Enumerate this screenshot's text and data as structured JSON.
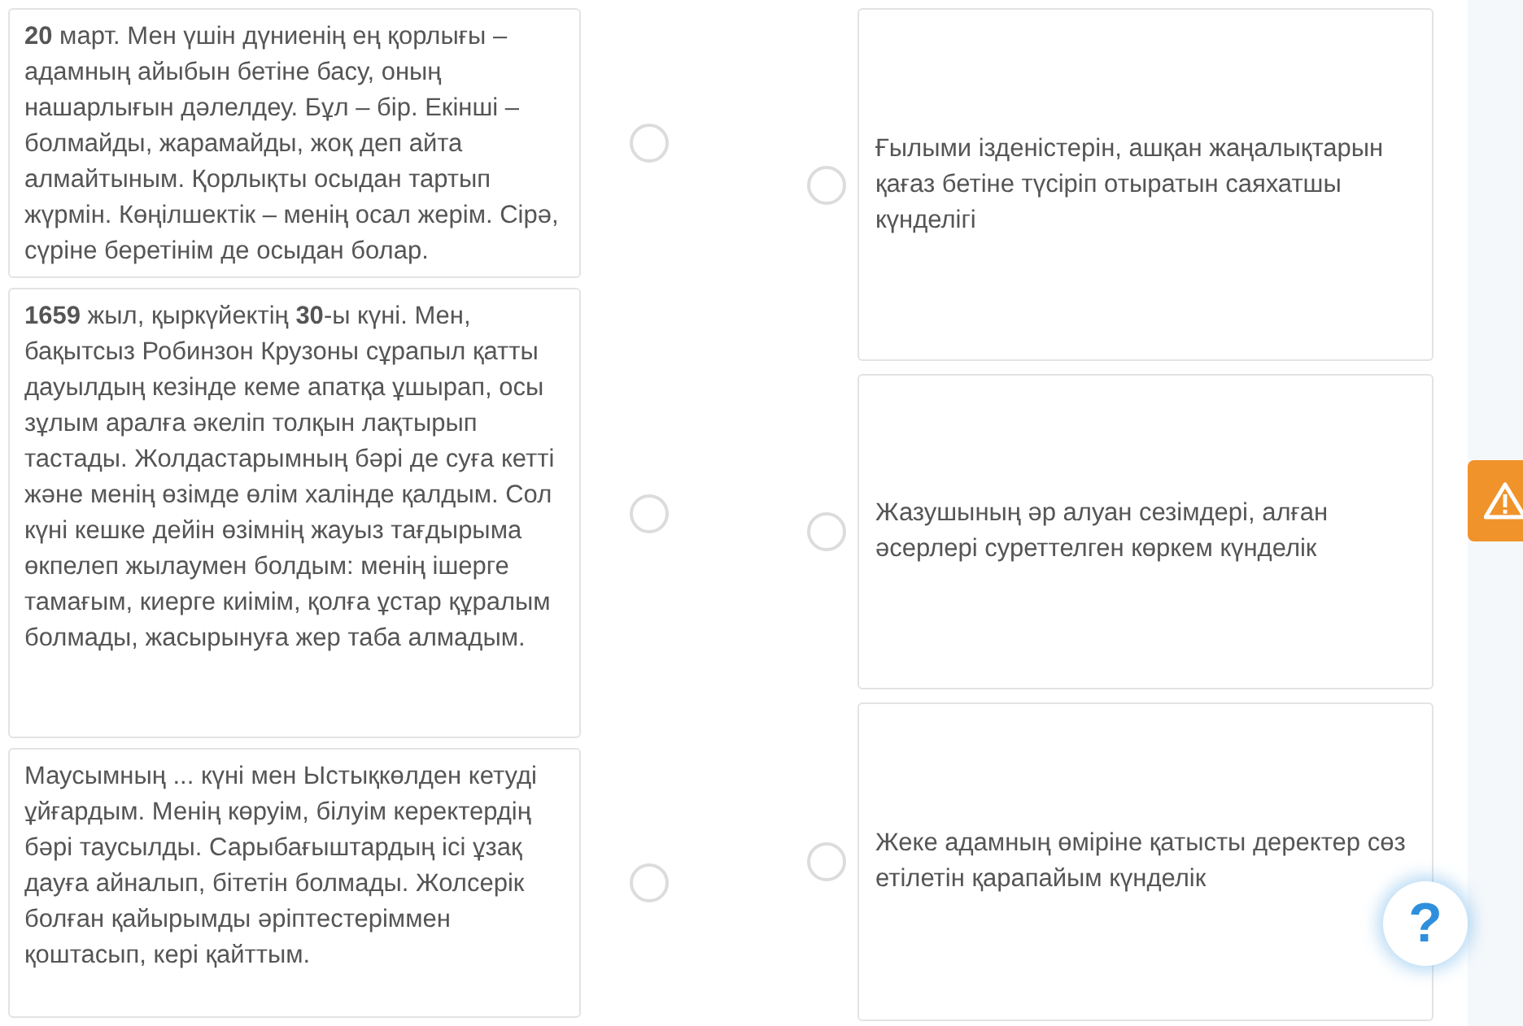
{
  "prompts": [
    {
      "text": "**20** март. Мен үшін дүниенің ең қорлығы – адамның айыбын бетіне басу, оның нашарлығын дәлелдеу. Бұл – бір. Екінші – болмайды, жарамайды, жоқ деп айта алмайтыным. Қорлықты осыдан тартып жүрмін. Көңілшектік – менің осал жерім. Сірә, сүріне беретінім де осыдан болар.",
      "selected": false
    },
    {
      "text": "**1659** жыл, қыркүйектің **30**-ы күні. Мен, бақытсыз Робинзон Крузоны сұрапыл қатты дауылдың кезінде кеме апатқа ұшырап, осы зұлым аралға әкеліп толқын лақтырып тастады. Жолдастарымның бәрі де суға кетті және менің өзімде өлім халінде қалдым. Сол күні кешке дейін өзімнің жауыз тағдырыма өкпелеп жылаумен болдым: менің ішерге тамағым, киерге киімім, қолға ұстар құралым болмады, жасырынуға жер таба алмадым.",
      "selected": false
    },
    {
      "text": "Маусымның ... күні мен Ыстықкөлден кетуді ұйғардым. Менің көруім, білуім керектердің бәрі таусылды. Сарыбағыштардың ісі ұзақ дауға айналып, бітетін болмады. Жолсерік болған қайырымды әріптестеріммен қоштасып, кері қайттым.",
      "selected": false
    }
  ],
  "answers": [
    {
      "text": "Ғылыми ізденістерін, ашқан жаңалықтарын қағаз бетіне түсіріп отыратын саяхатшы күнделігі",
      "selected": false
    },
    {
      "text": "Жазушының әр алуан сезімдері, алған әсерлері суреттелген көркем күнделік",
      "selected": false
    },
    {
      "text": "Жеке адамның өміріне қатысты деректер сөз етілетін қарапайым күнделік",
      "selected": false
    }
  ],
  "help_button": {
    "label": "?"
  }
}
